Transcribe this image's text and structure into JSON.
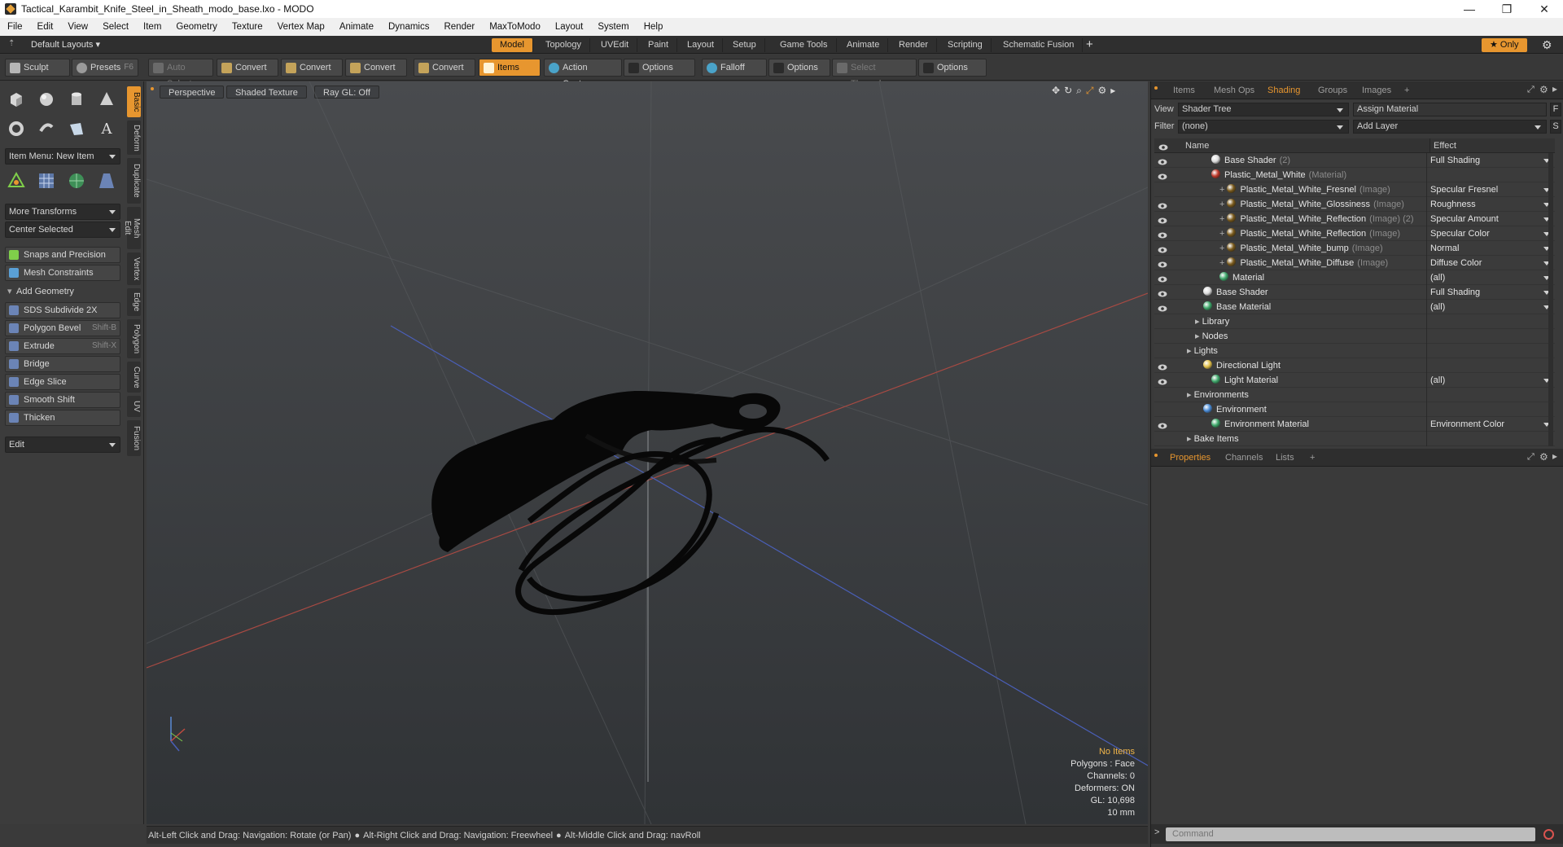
{
  "window": {
    "title": "Tactical_Karambit_Knife_Steel_in_Sheath_modo_base.lxo - MODO",
    "minimize": "—",
    "maximize": "❐",
    "close": "✕"
  },
  "menu": [
    "File",
    "Edit",
    "View",
    "Select",
    "Item",
    "Geometry",
    "Texture",
    "Vertex Map",
    "Animate",
    "Dynamics",
    "Render",
    "MaxToModo",
    "Layout",
    "System",
    "Help"
  ],
  "layout_bar": {
    "layouts_label": "Default Layouts",
    "tabs": [
      "Model",
      "Topology",
      "UVEdit",
      "Paint",
      "Layout",
      "Setup",
      "Game Tools",
      "Animate",
      "Render",
      "Scripting",
      "Schematic Fusion"
    ],
    "active_tab": "Model",
    "add": "+",
    "only_label": "★ Only"
  },
  "toolbar": {
    "sculpt": "Sculpt",
    "presets": "Presets",
    "presets_key": "F6",
    "auto_select": "Auto Select",
    "convert1": "Convert",
    "convert2": "Convert",
    "convert3": "Convert",
    "convert4": "Convert",
    "items": "Items",
    "action_center": "Action Center",
    "options1": "Options",
    "falloff": "Falloff",
    "options2": "Options",
    "select_through": "Select Through",
    "options3": "Options"
  },
  "left_panel": {
    "side_tabs": [
      "Basic",
      "Deform",
      "Duplicate",
      "Mesh Edit",
      "Vertex",
      "Edge",
      "Polygon",
      "Curve",
      "UV",
      "Fusion"
    ],
    "item_menu": "Item Menu: New Item",
    "more_transforms": "More Transforms",
    "center_selected": "Center Selected",
    "snaps": "Snaps and Precision",
    "mesh_constraints": "Mesh Constraints",
    "add_geometry": "Add Geometry",
    "tools": [
      {
        "label": "SDS Subdivide 2X",
        "shortcut": ""
      },
      {
        "label": "Polygon Bevel",
        "shortcut": "Shift-B"
      },
      {
        "label": "Extrude",
        "shortcut": "Shift-X"
      },
      {
        "label": "Bridge",
        "shortcut": ""
      },
      {
        "label": "Edge Slice",
        "shortcut": ""
      },
      {
        "label": "Smooth Shift",
        "shortcut": ""
      },
      {
        "label": "Thicken",
        "shortcut": ""
      }
    ],
    "edit": "Edit"
  },
  "viewport": {
    "view": "Perspective",
    "shading": "Shaded Texture",
    "raygl": "Ray GL: Off",
    "stats": {
      "items": "No Items",
      "polygons": "Polygons : Face",
      "channels": "Channels: 0",
      "deformers": "Deformers: ON",
      "gl": "GL: 10,698",
      "scale": "10 mm"
    }
  },
  "status_bar": {
    "hint1": "Alt-Left Click and Drag: Navigation: Rotate (or Pan)",
    "hint2": "Alt-Right Click and Drag: Navigation: Freewheel",
    "hint3": "Alt-Middle Click and Drag: navRoll"
  },
  "right_panel": {
    "tabs": [
      "Items",
      "Mesh Ops",
      "Shading",
      "Groups",
      "Images",
      "+"
    ],
    "active_tab": "Shading",
    "view_label": "View",
    "view_value": "Shader Tree",
    "assign_material": "Assign Material",
    "filter_label": "Filter",
    "filter_value": "(none)",
    "add_layer": "Add Layer",
    "col_name": "Name",
    "col_effect": "Effect",
    "rows": [
      {
        "name": "Base Shader",
        "sub": "(2)",
        "effect": "Full Shading",
        "indent": 3,
        "ball": "#dcdcdc",
        "eye": true,
        "drop": true,
        "plus": false
      },
      {
        "name": "Plastic_Metal_White",
        "sub": "(Material)",
        "effect": "",
        "indent": 3,
        "ball": "#c0392b",
        "eye": true,
        "drop": false,
        "plus": false
      },
      {
        "name": "Plastic_Metal_White_Fresnel",
        "sub": "(Image)",
        "effect": "Specular Fresnel",
        "indent": 4,
        "ball": "#7a5a1c",
        "eye": false,
        "drop": true,
        "plus": true
      },
      {
        "name": "Plastic_Metal_White_Glossiness",
        "sub": "(Image)",
        "effect": "Roughness",
        "indent": 4,
        "ball": "#7a5a1c",
        "eye": true,
        "drop": true,
        "plus": true
      },
      {
        "name": "Plastic_Metal_White_Reflection",
        "sub": "(Image) (2)",
        "effect": "Specular Amount",
        "indent": 4,
        "ball": "#7a5a1c",
        "eye": true,
        "drop": true,
        "plus": true
      },
      {
        "name": "Plastic_Metal_White_Reflection",
        "sub": "(Image)",
        "effect": "Specular Color",
        "indent": 4,
        "ball": "#7a5a1c",
        "eye": true,
        "drop": true,
        "plus": true
      },
      {
        "name": "Plastic_Metal_White_bump",
        "sub": "(Image)",
        "effect": "Normal",
        "indent": 4,
        "ball": "#7a5a1c",
        "eye": true,
        "drop": true,
        "plus": true
      },
      {
        "name": "Plastic_Metal_White_Diffuse",
        "sub": "(Image)",
        "effect": "Diffuse Color",
        "indent": 4,
        "ball": "#7a5a1c",
        "eye": true,
        "drop": true,
        "plus": true
      },
      {
        "name": "Material",
        "sub": "",
        "effect": "(all)",
        "indent": 4,
        "ball": "#3fa86b",
        "eye": true,
        "drop": true,
        "plus": false
      },
      {
        "name": "Base Shader",
        "sub": "",
        "effect": "Full Shading",
        "indent": 2,
        "ball": "#dcdcdc",
        "eye": true,
        "drop": true,
        "plus": false
      },
      {
        "name": "Base Material",
        "sub": "",
        "effect": "(all)",
        "indent": 2,
        "ball": "#3fa86b",
        "eye": true,
        "drop": true,
        "plus": false
      },
      {
        "name": "Library",
        "sub": "",
        "effect": "",
        "indent": 1,
        "ball": "",
        "eye": false,
        "drop": false,
        "plus": false
      },
      {
        "name": "Nodes",
        "sub": "",
        "effect": "",
        "indent": 1,
        "ball": "",
        "eye": false,
        "drop": false,
        "plus": false
      },
      {
        "name": "Lights",
        "sub": "",
        "effect": "",
        "indent": 0,
        "ball": "",
        "eye": false,
        "drop": false,
        "plus": false
      },
      {
        "name": "Directional Light",
        "sub": "",
        "effect": "",
        "indent": 2,
        "ball": "#e2c04a",
        "eye": true,
        "drop": false,
        "plus": false
      },
      {
        "name": "Light Material",
        "sub": "",
        "effect": "(all)",
        "indent": 3,
        "ball": "#3fa86b",
        "eye": true,
        "drop": true,
        "plus": false
      },
      {
        "name": "Environments",
        "sub": "",
        "effect": "",
        "indent": 0,
        "ball": "",
        "eye": false,
        "drop": false,
        "plus": false
      },
      {
        "name": "Environment",
        "sub": "",
        "effect": "",
        "indent": 2,
        "ball": "#4a8bd6",
        "eye": false,
        "drop": false,
        "plus": false
      },
      {
        "name": "Environment Material",
        "sub": "",
        "effect": "Environment Color",
        "indent": 3,
        "ball": "#3fa86b",
        "eye": true,
        "drop": true,
        "plus": false
      },
      {
        "name": "Bake Items",
        "sub": "",
        "effect": "",
        "indent": 0,
        "ball": "",
        "eye": false,
        "drop": false,
        "plus": false
      }
    ],
    "prop_tabs": [
      "Properties",
      "Channels",
      "Lists",
      "+"
    ],
    "prop_active": "Properties",
    "command_placeholder": "Command"
  },
  "colors": {
    "accent": "#e7962f",
    "viewport_top": "#494b4e",
    "viewport_bottom": "#303336"
  }
}
